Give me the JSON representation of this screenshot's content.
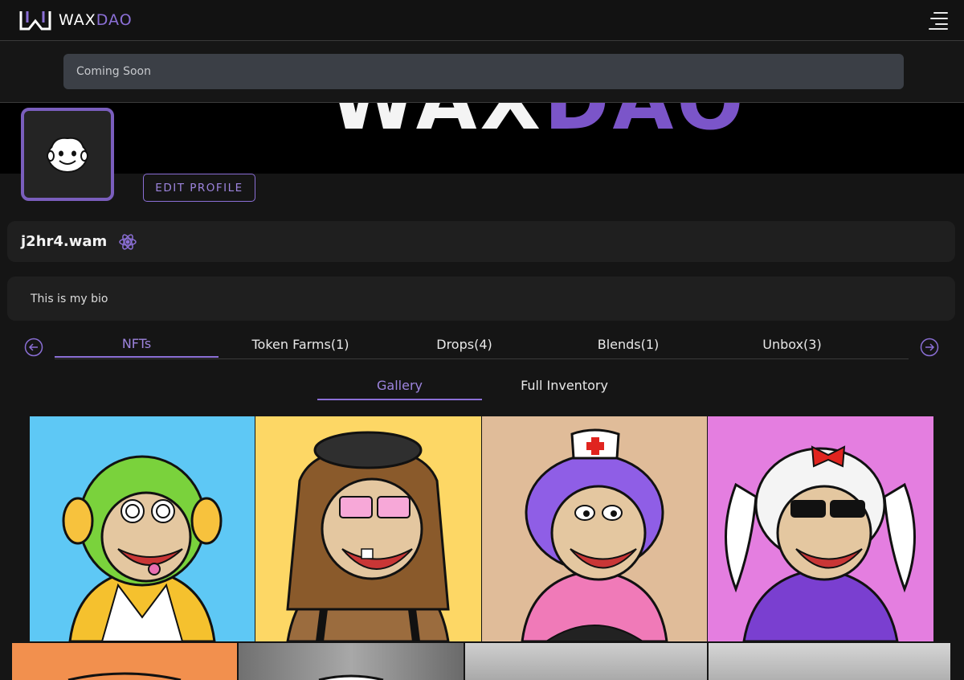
{
  "header": {
    "logo_wax": "WAX",
    "logo_dao": "DAO",
    "menu_icon": "hamburger-menu-icon"
  },
  "announcement": {
    "text": "Coming Soon"
  },
  "banner": {
    "text_left": "WAX",
    "text_right": "DAO"
  },
  "profile": {
    "edit_label": "EDIT PROFILE",
    "username": "j2hr4.wam",
    "badge_icon": "atom-badge-icon",
    "bio": "This is my bio"
  },
  "tabs": [
    {
      "label": "NFTs",
      "active": true
    },
    {
      "label": "Token Farms(1)",
      "active": false
    },
    {
      "label": "Drops(4)",
      "active": false
    },
    {
      "label": "Blends(1)",
      "active": false
    },
    {
      "label": "Unbox(3)",
      "active": false
    }
  ],
  "subtabs": [
    {
      "label": "Gallery",
      "active": true
    },
    {
      "label": "Full Inventory",
      "active": false
    }
  ],
  "gallery": {
    "row1_colors": [
      "#5ec8f5",
      "#fdd765",
      "#e0bc99",
      "#e47ee0"
    ],
    "row2_colors": [
      "#f2904e",
      "#8a8a8a",
      "#b7b7b7",
      "#c4c4c4"
    ]
  },
  "colors": {
    "accent": "#8b6fd6",
    "panel": "#1f1f1f",
    "background": "#151515"
  }
}
